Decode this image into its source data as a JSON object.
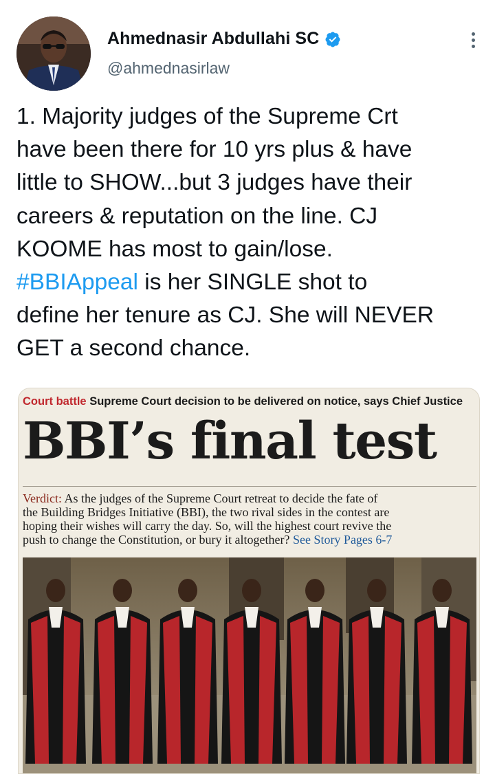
{
  "author": {
    "name": "Ahmednasir Abdullahi SC",
    "handle": "@ahmednasirlaw",
    "verified": true
  },
  "tweet": {
    "text_lines": [
      "1. Majority judges of the Supreme Crt",
      "have been there for 10 yrs plus & have",
      "little to SHOW...but 3 judges have their",
      "careers & reputation on the line. CJ",
      "KOOME has most to gain/lose.",
      "#BBIAppeal",
      " is her SINGLE shot to",
      "define her tenure as CJ. She will NEVER",
      "GET a second chance."
    ]
  },
  "newspaper": {
    "kicker": "Court battle",
    "deck": "Supreme Court decision to be delivered on notice, says Chief Justice",
    "headline": "BBI’s final test",
    "verdict_label": "Verdict:",
    "verdict_text": " As the judges of the Supreme Court retreat to decide the fate of\nthe Building Bridges Initiative (BBI), the two rival sides in the contest are\nhoping their wishes will carry the day. So, will the highest court revive the\npush to change the Constitution, or bury it altogether? ",
    "see_story": "See Story Pages 6-7"
  },
  "colors": {
    "hashtag": "#1d9bf0",
    "verified": "#1d9bf0",
    "kicker": "#c0272d",
    "robe_red": "#b8262b",
    "robe_black": "#151515"
  },
  "icons": {
    "verified": "verified-badge-icon",
    "more": "more-dots-icon"
  }
}
